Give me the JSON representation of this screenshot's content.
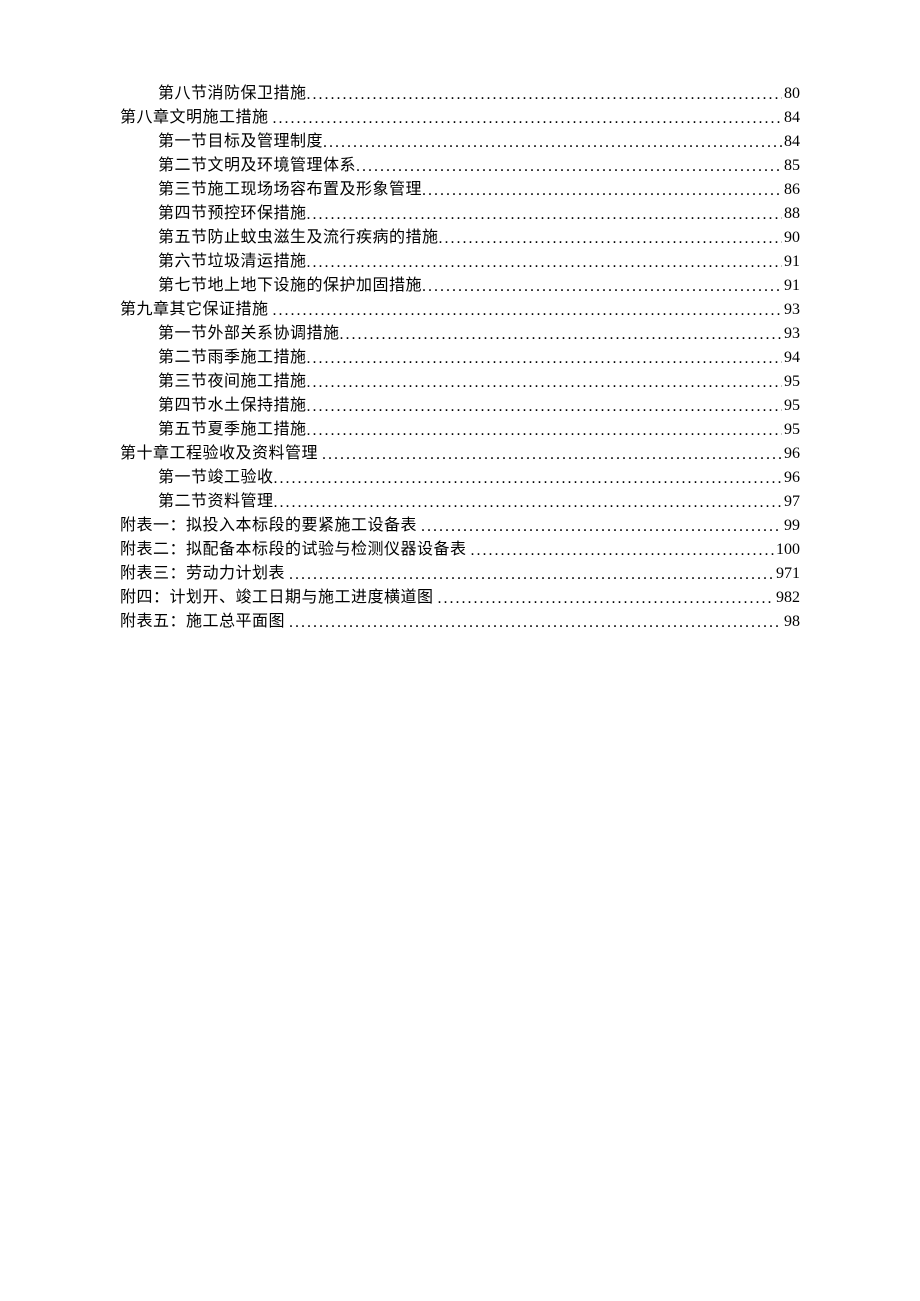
{
  "toc": [
    {
      "level": 2,
      "title": "第八节消防保卫措施",
      "page": "80"
    },
    {
      "level": 1,
      "title": "第八章文明施工措施",
      "page": "84",
      "titleSpace": true
    },
    {
      "level": 2,
      "title": "第一节目标及管理制度",
      "page": "84"
    },
    {
      "level": 2,
      "title": "第二节文明及环境管理体系",
      "page": "85"
    },
    {
      "level": 2,
      "title": "第三节施工现场场容布置及形象管理",
      "page": "86"
    },
    {
      "level": 2,
      "title": "第四节预控环保措施",
      "page": "88"
    },
    {
      "level": 2,
      "title": "第五节防止蚊虫滋生及流行疾病的措施",
      "page": "90"
    },
    {
      "level": 2,
      "title": "第六节垃圾清运措施",
      "page": "91"
    },
    {
      "level": 2,
      "title": "第七节地上地下设施的保护加固措施",
      "page": "91"
    },
    {
      "level": 1,
      "title": "第九章其它保证措施",
      "page": "93",
      "titleSpace": true
    },
    {
      "level": 2,
      "title": "第一节外部关系协调措施",
      "page": "93"
    },
    {
      "level": 2,
      "title": "第二节雨季施工措施",
      "page": "94"
    },
    {
      "level": 2,
      "title": "第三节夜间施工措施",
      "page": "95"
    },
    {
      "level": 2,
      "title": "第四节水土保持措施",
      "page": "95"
    },
    {
      "level": 2,
      "title": "第五节夏季施工措施",
      "page": "95"
    },
    {
      "level": 1,
      "title": "第十章工程验收及资料管理",
      "page": "96",
      "titleSpace": true
    },
    {
      "level": 2,
      "title": "第一节竣工验收",
      "page": "96"
    },
    {
      "level": 2,
      "title": "第二节资料管理",
      "page": "97"
    },
    {
      "level": 1,
      "title": "附表一：拟投入本标段的要紧施工设备表",
      "page": "99",
      "titleSpace": true
    },
    {
      "level": 1,
      "title": "附表二：拟配备本标段的试验与检测仪器设备表",
      "page": "100",
      "titleSpace": true
    },
    {
      "level": 1,
      "title": "附表三：劳动力计划表",
      "page": "971",
      "titleSpace": true
    },
    {
      "level": 1,
      "title": "附四：计划开、竣工日期与施工进度横道图",
      "page": "982",
      "titleSpace": true
    },
    {
      "level": 1,
      "title": "附表五：施工总平面图",
      "page": "98",
      "titleSpace": true
    }
  ]
}
